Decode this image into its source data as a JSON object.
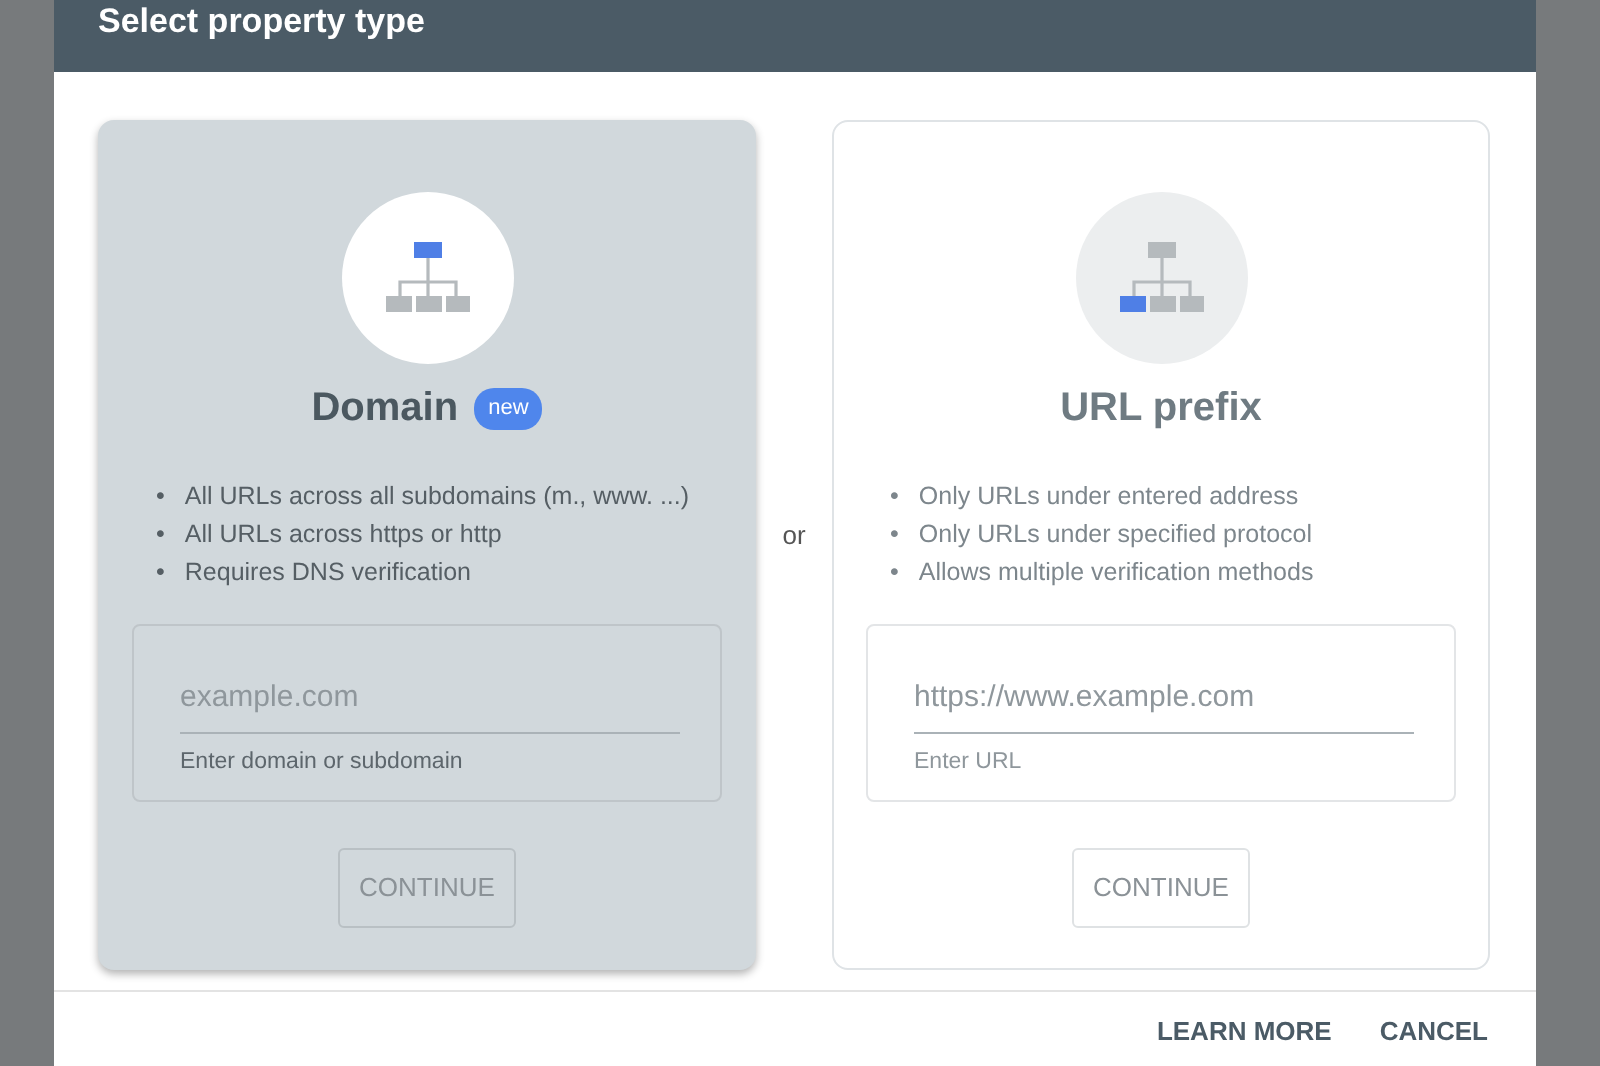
{
  "dialog": {
    "title": "Select property type",
    "options": [
      {
        "kind": "domain",
        "selected": true,
        "title": "Domain",
        "badge": "new",
        "bullets": [
          {
            "marker": "•",
            "text": "All URLs across all subdomains (m., www. ...)"
          },
          {
            "marker": "•",
            "text": "All URLs across https or http"
          },
          {
            "marker": "•",
            "text": "Requires DNS verification"
          }
        ],
        "placeholder": "example.com",
        "hint": "Enter domain or subdomain",
        "button": "CONTINUE"
      },
      {
        "kind": "url_prefix",
        "selected": false,
        "title": "URL prefix",
        "bullets": [
          {
            "marker": "•",
            "text": "Only URLs under entered address"
          },
          {
            "marker": "•",
            "text": "Only URLs under specified protocol"
          },
          {
            "marker": "•",
            "text": "Allows multiple verification methods"
          }
        ],
        "placeholder": "https://www.example.com",
        "hint": "Enter URL",
        "button": "CONTINUE"
      }
    ],
    "separator": "or",
    "footer_buttons": [
      "LEARN MORE",
      "CANCEL"
    ]
  }
}
